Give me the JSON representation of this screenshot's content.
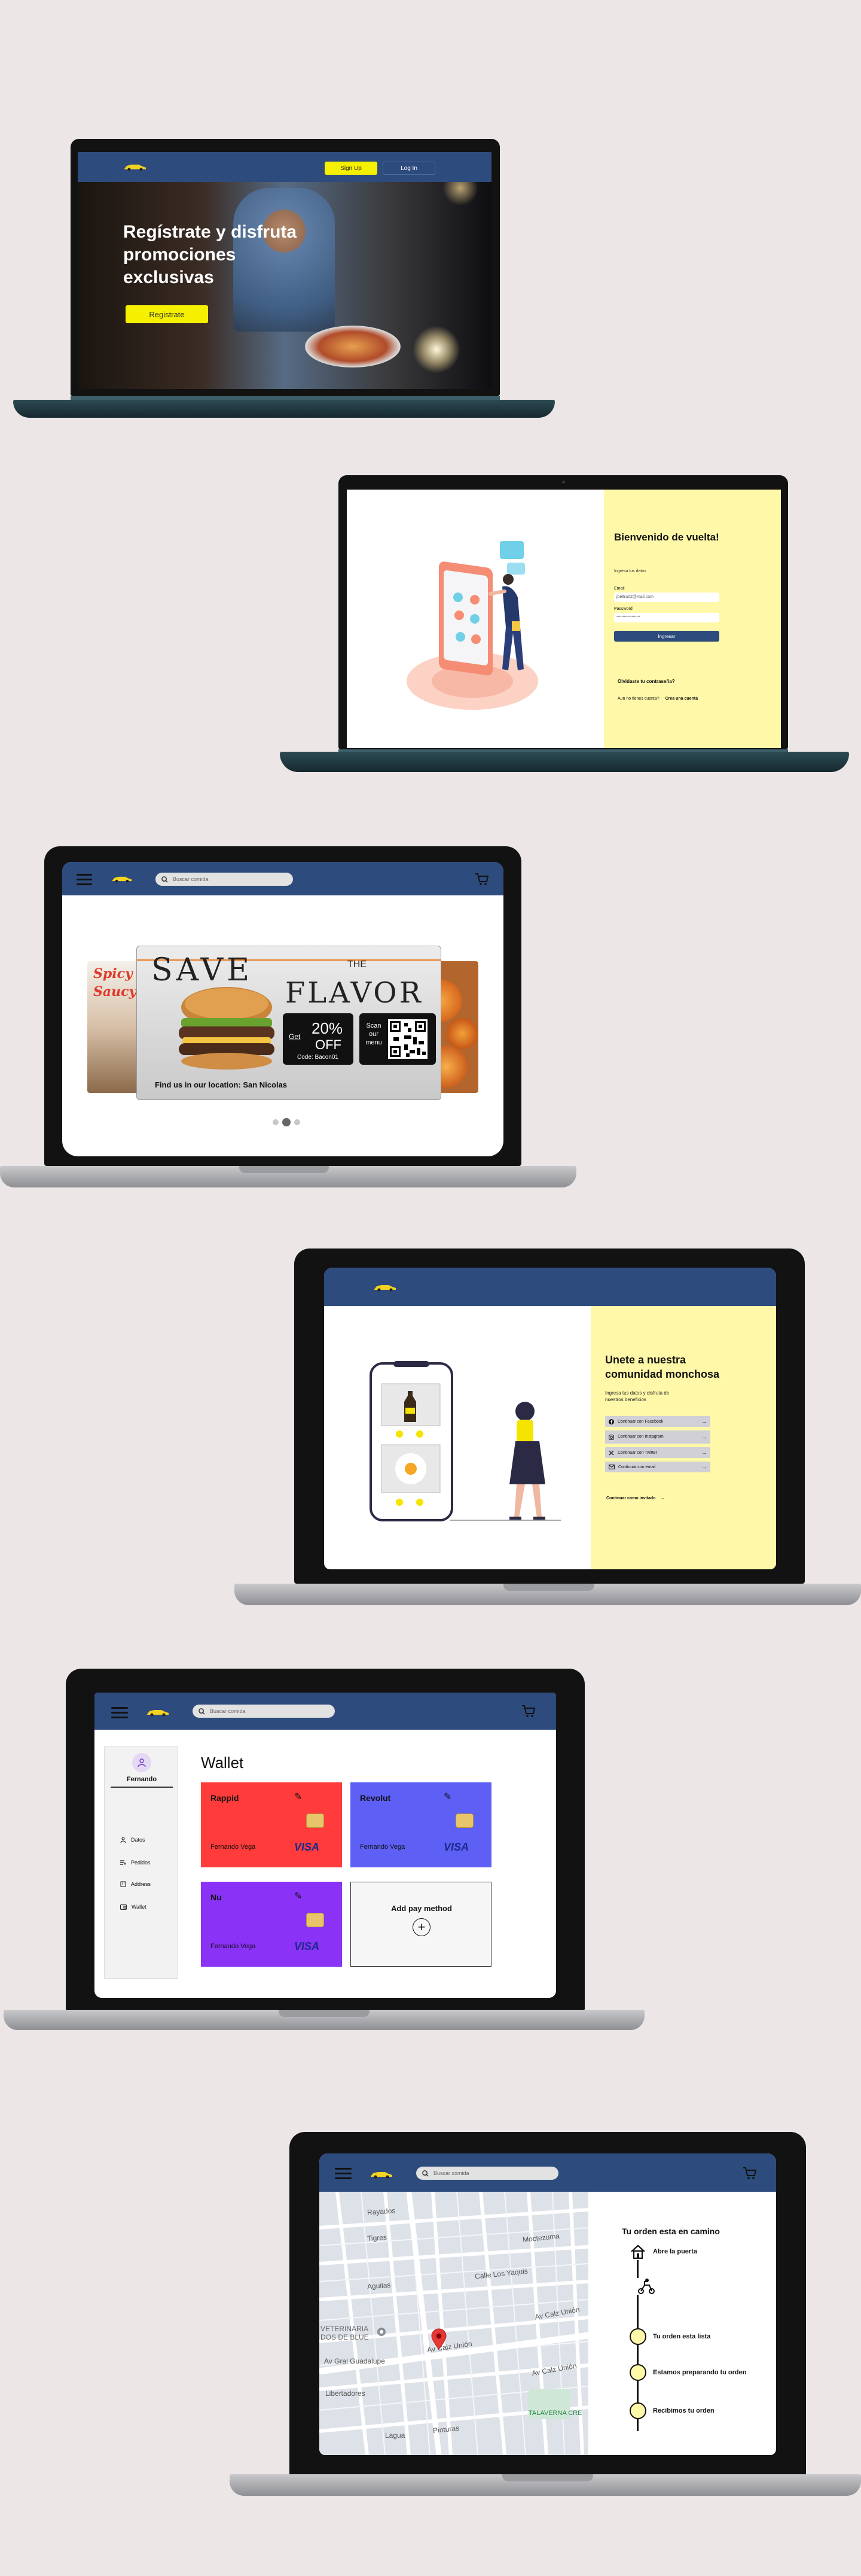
{
  "s1": {
    "signup_label": "Sign Up",
    "login_label": "Log In",
    "hero_title": "Regístrate y disfruta promociones exclusivas",
    "cta_label": "Registrate"
  },
  "s2": {
    "title": "Bienvenido de vuelta!",
    "subtitle": "Ingresa tus datos",
    "email_label": "Email",
    "email_value": "jbeltra02@mail.com",
    "password_label": "Password",
    "password_value": "•••••••••••••••••••",
    "login_button": "Ingresar",
    "forgot": "Olvidaste tu contraseña?",
    "no_account": "Aun no tienes cuenta?",
    "create_account": "Crea una cuenta"
  },
  "s3": {
    "search_placeholder": "Buscar comida",
    "left_card_1": "Spicy",
    "left_card_2": "Saucy",
    "ad_save": "SAVE",
    "ad_the": "THE",
    "ad_flavor": "FLAVOR",
    "coupon_get": "Get",
    "coupon_percent": "20%",
    "coupon_off": "OFF",
    "coupon_code": "Code: Bacon01",
    "scan_text": "Scan our menu",
    "location": "Find us in our location: San Nicolas"
  },
  "s4": {
    "title": "Unete a nuestra comunidad monchosa",
    "subtitle": "Ingresa tus datos y disfruta de nuestros beneficios",
    "options": [
      {
        "icon": "facebook-icon",
        "label": "Continuar con Facebook"
      },
      {
        "icon": "instagram-icon",
        "label": "Continuar con Instagram"
      },
      {
        "icon": "twitter-icon",
        "label": "Continuar con Twitter"
      },
      {
        "icon": "mail-icon",
        "label": "Continuar con email"
      }
    ],
    "guest": "Continuar como invitado"
  },
  "s5": {
    "search_placeholder": "Buscar comida",
    "user_name": "Fernando",
    "menu": [
      "Datos",
      "Pedidos",
      "Address",
      "Wallet"
    ],
    "title": "Wallet",
    "cards": [
      {
        "name": "Rappid",
        "holder": "Fernando Vega",
        "brand": "VISA",
        "color": "#ff3b3b"
      },
      {
        "name": "Revolut",
        "holder": "Fernando Vega",
        "brand": "VISA",
        "color": "#5d5ff5"
      },
      {
        "name": "Nu",
        "holder": "Fernando Vega",
        "brand": "VISA",
        "color": "#8a32f5"
      }
    ],
    "add_label": "Add pay method"
  },
  "s6": {
    "search_placeholder": "Buscar comida",
    "map_labels": [
      "Rayados",
      "Tigres",
      "Aguilas",
      "Av Calz Unión",
      "VETERINARIA",
      "DOS DE BLUE",
      "Pinturas",
      "Av Calz Unión",
      "TALAVERNA CRE",
      "Moctezuma",
      "Calle Los Yaquis",
      "Av Calz Unión",
      "Lagua",
      "Libertadores",
      "Av Gral Guadalupe"
    ],
    "order_title": "Tu orden esta en camino",
    "steps": [
      "Abre la puerta",
      "Tu orden esta lista",
      "Estamos preparando tu orden",
      "Recibimos tu orden"
    ]
  },
  "colors": {
    "navy": "#2d4b7d",
    "yellow": "#fff06a",
    "cream": "#fff8a8",
    "teal": "#2d4a53"
  }
}
